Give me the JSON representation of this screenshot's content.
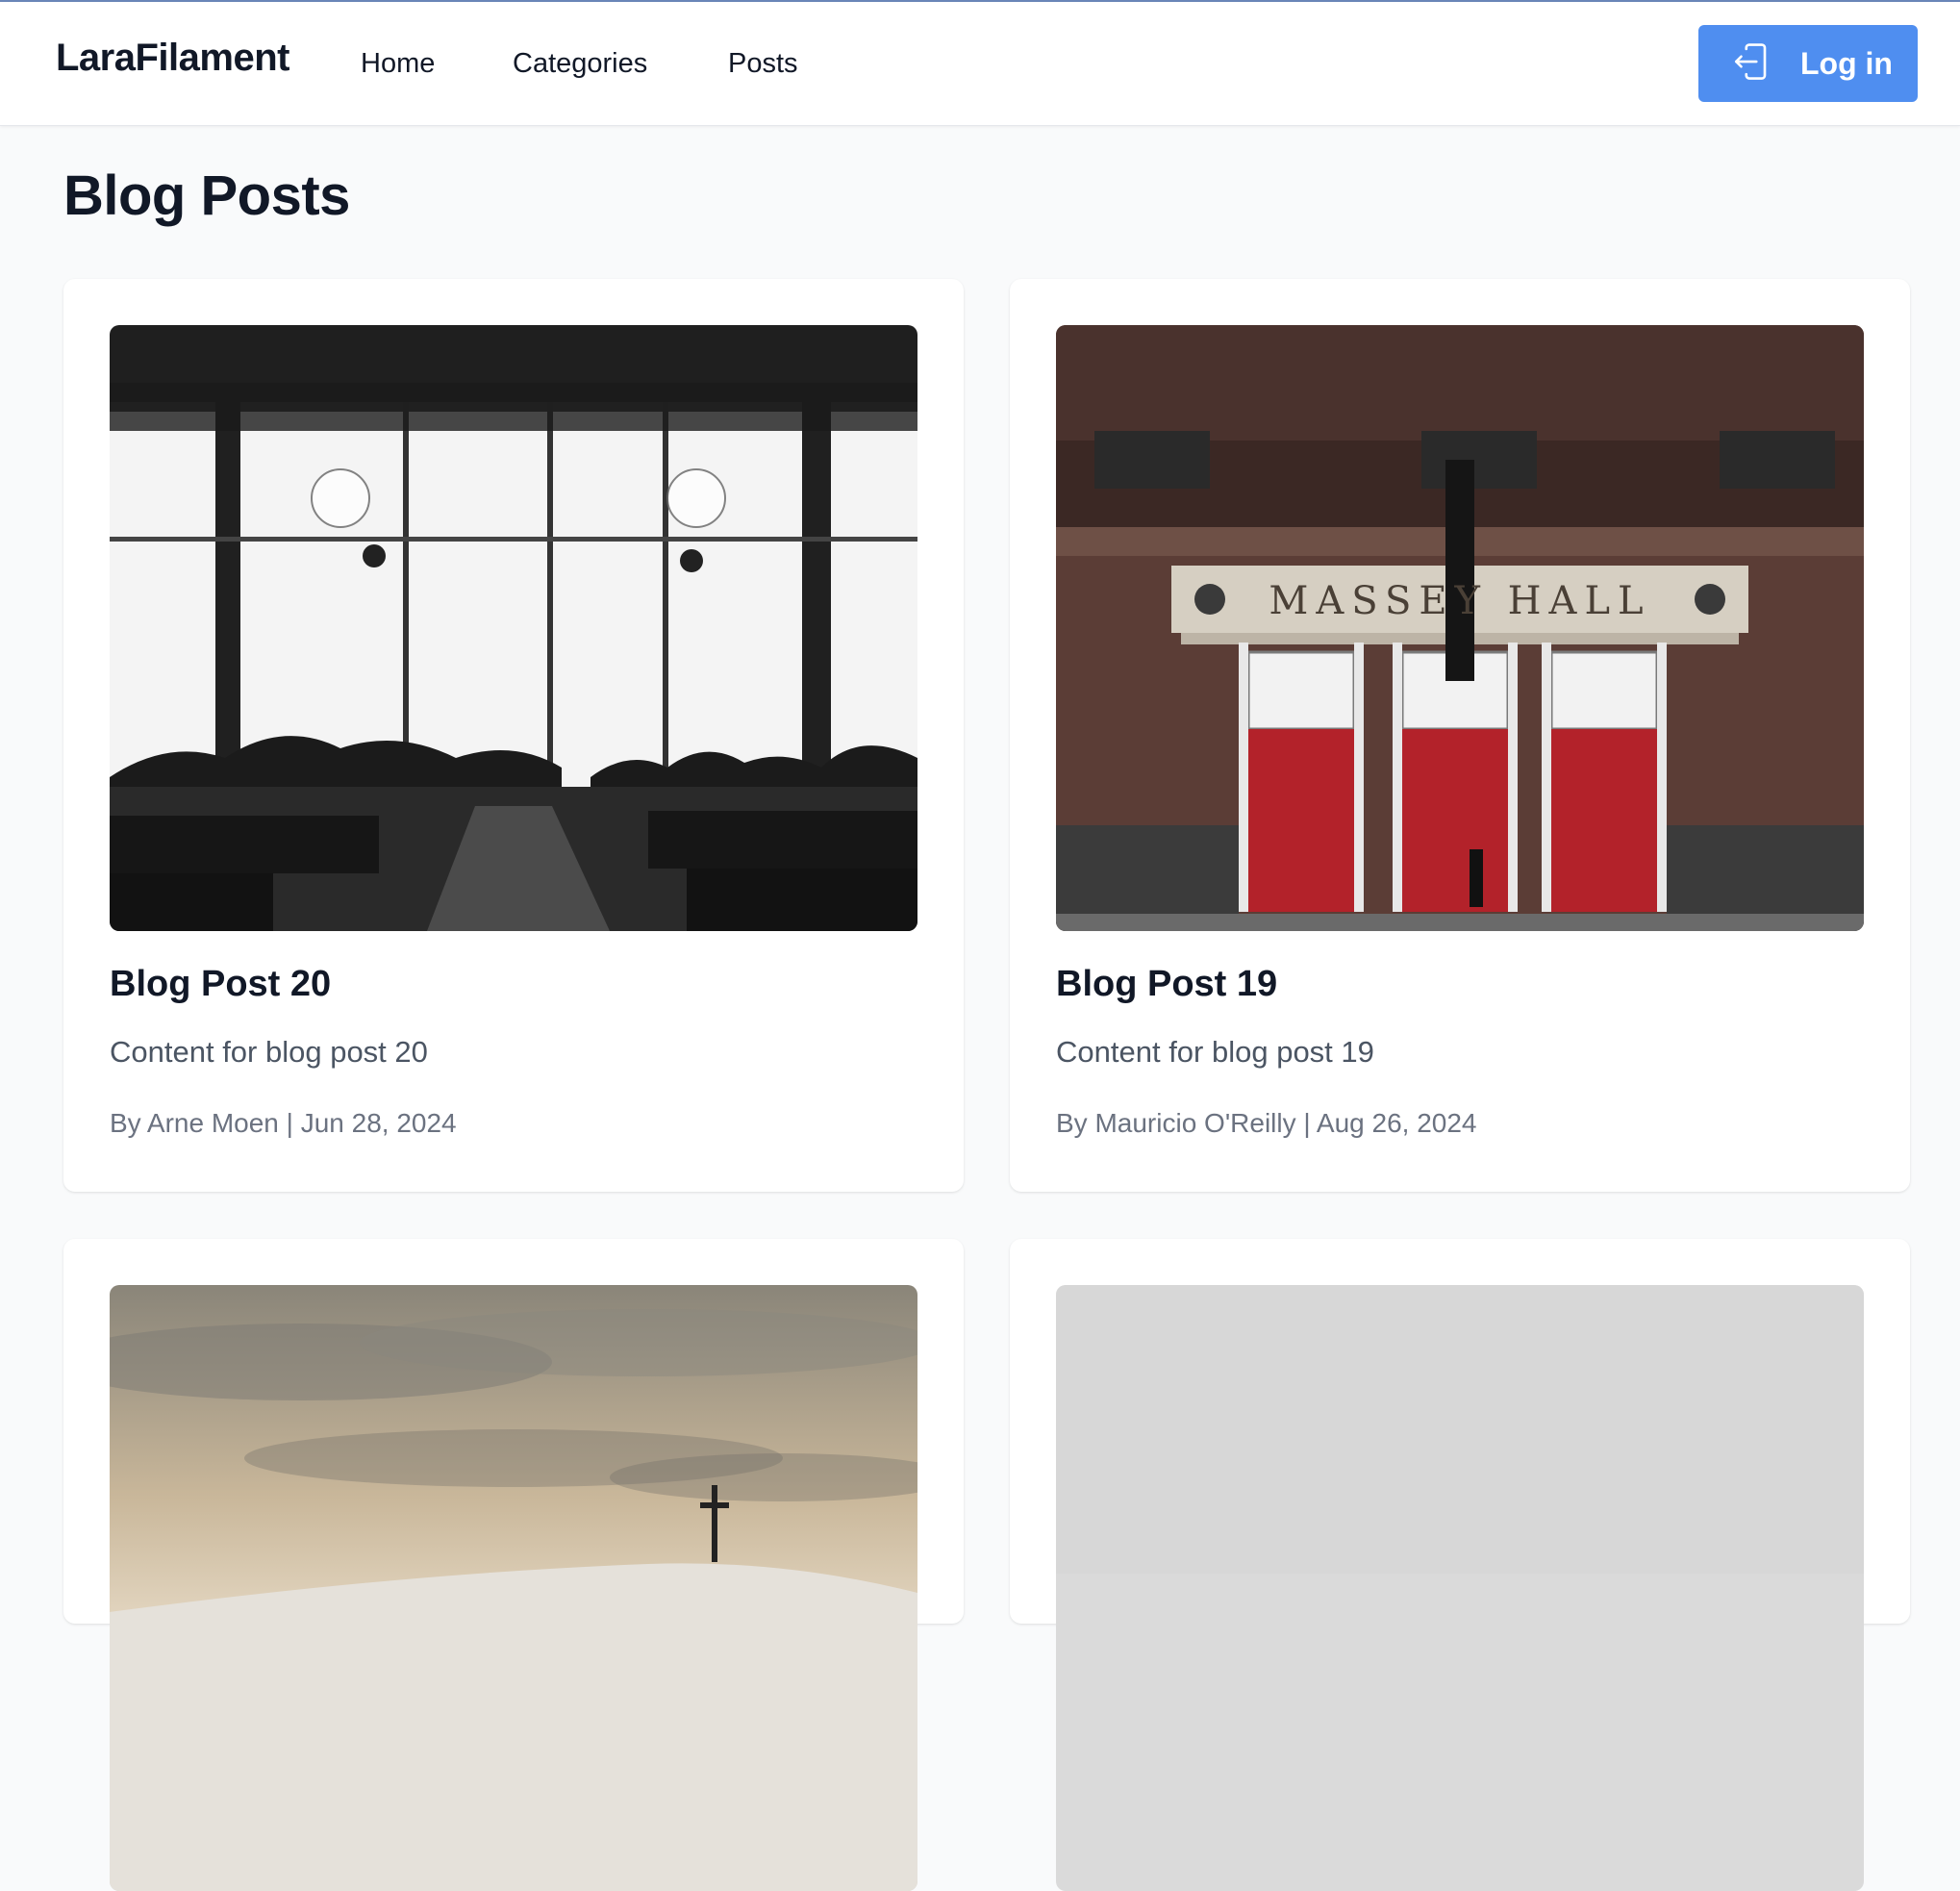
{
  "brand": "LaraFilament",
  "nav": [
    {
      "label": "Home"
    },
    {
      "label": "Categories"
    },
    {
      "label": "Posts"
    }
  ],
  "login": {
    "label": "Log in",
    "icon": "login-icon"
  },
  "page_title": "Blog Posts",
  "posts": [
    {
      "title": "Blog Post 20",
      "excerpt": "Content for blog post 20",
      "meta": "By Arne Moen | Jun 28, 2024",
      "image": "cafe-interior-silhouettes-photo"
    },
    {
      "title": "Blog Post 19",
      "excerpt": "Content for blog post 19",
      "meta": "By Mauricio O'Reilly | Aug 26, 2024",
      "image": "massey-hall-facade-photo",
      "image_text": "MASSEY HALL"
    },
    {
      "image": "cross-on-hill-sunset-photo"
    },
    {
      "image": "grey-sky-photo"
    }
  ],
  "colors": {
    "accent": "#4f8ef0",
    "page_background": "#f9fafb",
    "card_background": "#ffffff",
    "muted_text": "#6b7280"
  }
}
